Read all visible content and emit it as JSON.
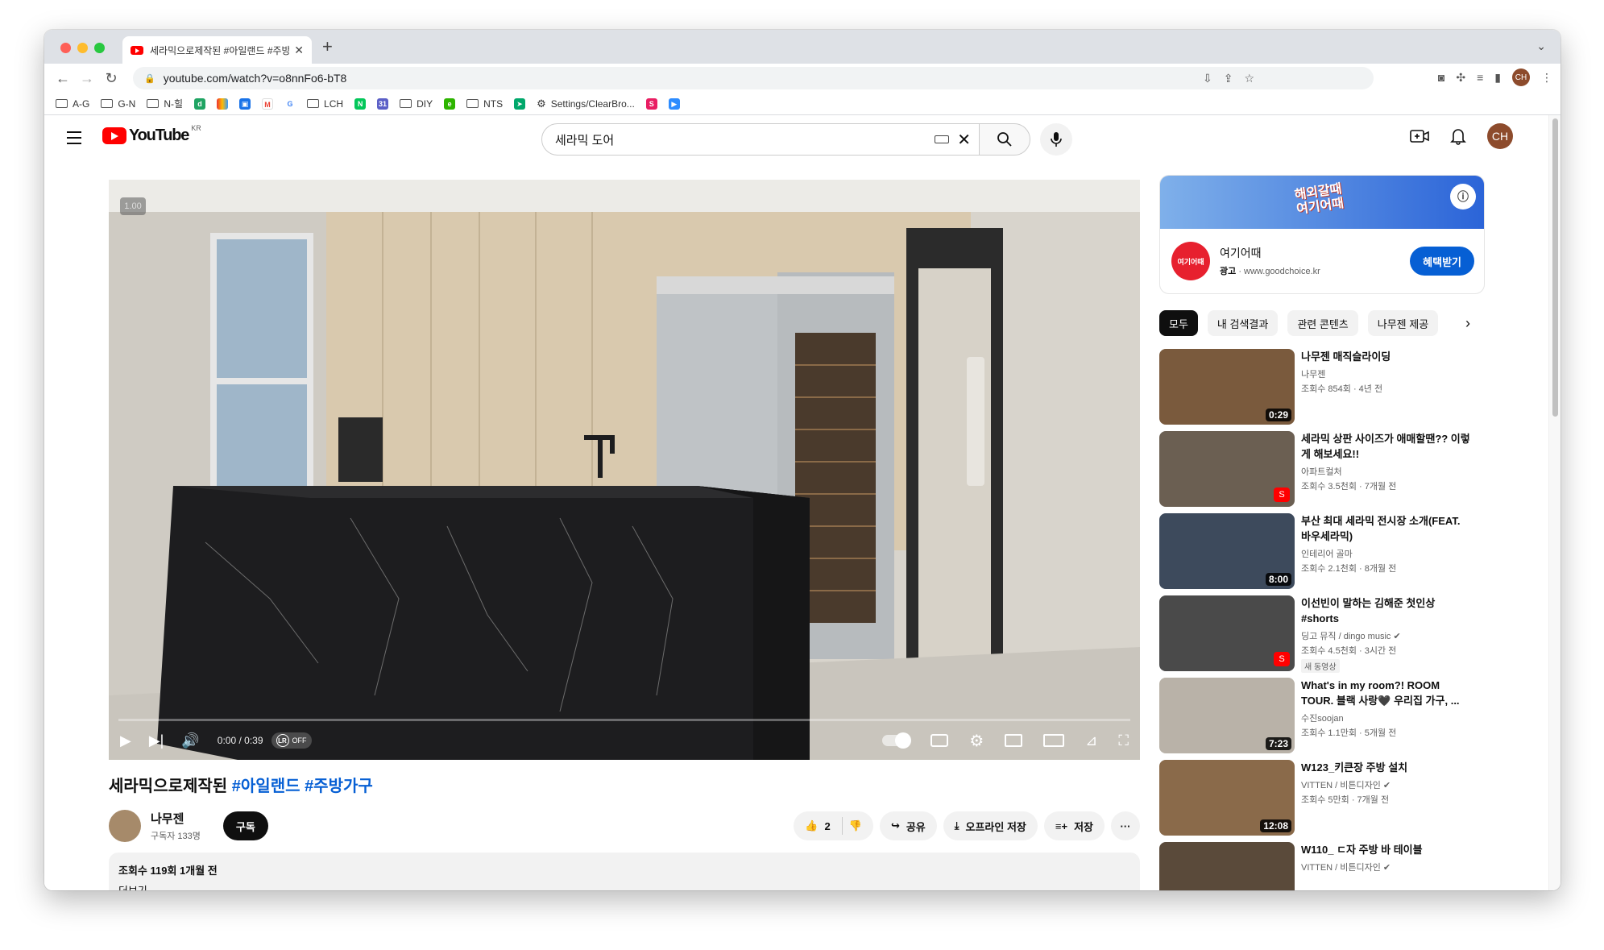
{
  "browser": {
    "tab_title": "세라믹으로제작된 #아일랜드 #주방가구",
    "url": "youtube.com/watch?v=o8nnFo6-bT8",
    "profile_initials": "CH",
    "bookmarks": [
      "A-G",
      "G-N",
      "N-힐",
      "LCH",
      "DIY",
      "NTS",
      "Settings/ClearBro..."
    ]
  },
  "youtube": {
    "logo_text": "YouTube",
    "region": "KR",
    "search_value": "세라믹 도어",
    "avatar_initials": "CH"
  },
  "player": {
    "badge": "1.00",
    "time": "0:00 / 0:39",
    "lr_label": "LR",
    "lr_state": "OFF",
    "progress": 0.0
  },
  "video": {
    "title_plain": "세라믹으로제작된",
    "title_tag1": "#아일랜드",
    "title_tag2": "#주방가구",
    "channel": "나무젠",
    "subscribers": "구독자 133명",
    "subscribe_label": "구독",
    "likes": "2",
    "share_label": "공유",
    "offline_label": "오프라인 저장",
    "save_label": "저장",
    "more_label": "···",
    "views_date": "조회수 119회  1개월 전",
    "more_desc": "더보기"
  },
  "ad": {
    "banner_line1": "해외갈때",
    "banner_line2": "여기어때",
    "logo_text": "여기어때",
    "name": "여기어때",
    "label": "광고",
    "domain": "· www.goodchoice.kr",
    "cta": "혜택받기"
  },
  "chips": [
    "모두",
    "내 검색결과",
    "관련 콘텐츠",
    "나무젠 제공"
  ],
  "recommendations": [
    {
      "title": "나무젠 매직슬라이딩",
      "channel": "나무젠",
      "meta": "조회수 854회 · 4년 전",
      "duration": "0:29",
      "short": false,
      "color": "#7a5a3d",
      "new": ""
    },
    {
      "title": "세라믹 상판 사이즈가 애매할땐?? 이렇게 해보세요!!",
      "channel": "아파트컬처",
      "meta": "조회수 3.5천회 · 7개월 전",
      "duration": "",
      "short": true,
      "color": "#6b5f52",
      "new": ""
    },
    {
      "title": "부산 최대 세라믹 전시장 소개(FEAT. 바우세라믹)",
      "channel": "인테리어 골마",
      "meta": "조회수 2.1천회 · 8개월 전",
      "duration": "8:00",
      "short": false,
      "color": "#3d4a5c",
      "new": ""
    },
    {
      "title": "이선빈이 말하는 김해준 첫인상 #shorts",
      "channel": "딩고 뮤직 / dingo music ✔",
      "meta": "조회수 4.5천회 · 3시간 전",
      "duration": "",
      "short": true,
      "color": "#4a4a4a",
      "new": "새 동영상"
    },
    {
      "title": "What's in my room?! ROOM TOUR. 블랙 사랑🖤 우리집 가구, ...",
      "channel": "수진soojan",
      "meta": "조회수 1.1만회 · 5개월 전",
      "duration": "7:23",
      "short": false,
      "color": "#b9b2a8",
      "new": ""
    },
    {
      "title": "W123_키큰장 주방 설치",
      "channel": "VITTEN / 비튼디자인 ✔",
      "meta": "조회수 5만회 · 7개월 전",
      "duration": "12:08",
      "short": false,
      "color": "#8a6a4a",
      "new": ""
    },
    {
      "title": "W110_ ㄷ자 주방 바 테이블",
      "channel": "VITTEN / 비튼디자인 ✔",
      "meta": "",
      "duration": "",
      "short": false,
      "color": "#5a4a3a",
      "new": ""
    }
  ]
}
